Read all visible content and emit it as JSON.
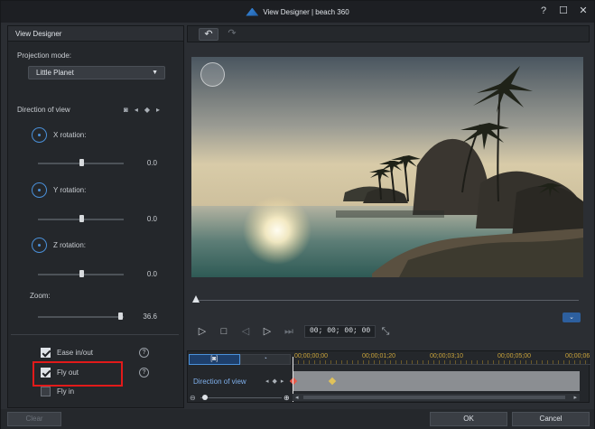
{
  "window": {
    "title": "View Designer  |  beach 360"
  },
  "left_panel": {
    "title": "View Designer",
    "projection_label": "Projection mode:",
    "projection_value": "Little Planet",
    "direction_label": "Direction of view",
    "rotations": [
      {
        "label": "X rotation:",
        "value": "0.0",
        "level_percent": 50
      },
      {
        "label": "Y rotation:",
        "value": "0.0",
        "level_percent": 50
      },
      {
        "label": "Z rotation:",
        "value": "0.0",
        "level_percent": 50
      }
    ],
    "zoom": {
      "label": "Zoom:",
      "value": "36.6",
      "level_percent": 96
    },
    "ease_in_out": {
      "label": "Ease in/out",
      "checked": true
    },
    "fly_out": {
      "label": "Fly out",
      "checked": true
    },
    "fly_in": {
      "label": "Fly in",
      "checked": false
    },
    "clear_label": "Clear"
  },
  "player": {
    "timecode": "00; 00; 00; 00",
    "scrub_percent": 0
  },
  "timeline": {
    "ticks": [
      "00;00;00;00",
      "00;00;01;20",
      "00;00;03;10",
      "00;00;05;00",
      "00;00;06"
    ],
    "track_label": "Direction of view",
    "keyframe_times": [
      "00;00;00;00",
      "00;00;01;12"
    ]
  },
  "footer": {
    "ok_label": "OK",
    "cancel_label": "Cancel"
  },
  "colors": {
    "accent": "#4a90d9",
    "highlight_box": "#e21a1a",
    "keyframe": "#e0c25a"
  },
  "icons": [
    "logo-icon",
    "help-icon",
    "maximize-icon",
    "close-icon",
    "undo-icon",
    "redo-icon",
    "rotation-icon",
    "keyframe-icon",
    "play-icon",
    "stop-icon",
    "fit-icon"
  ]
}
